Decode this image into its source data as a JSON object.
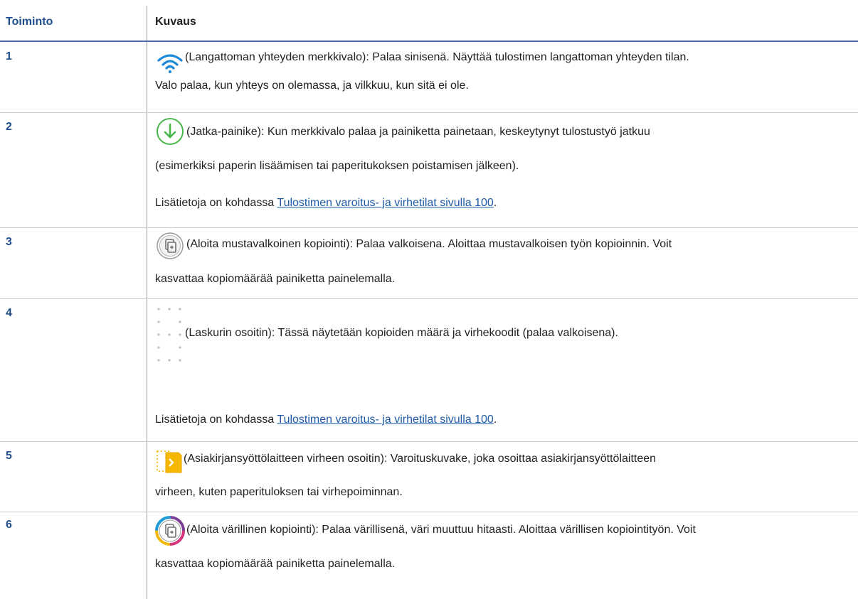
{
  "header": {
    "col1": "Toiminto",
    "col2": "Kuvaus"
  },
  "colors": {
    "accent": "#1f4f8f",
    "link": "#1f5aa6",
    "wifi": "#1e88d8",
    "resume": "#49b84a"
  },
  "rows": [
    {
      "num": "1",
      "icon": "wifi-icon",
      "lines": [
        "(Langattoman yhteyden merkkivalo): Palaa sinisenä. Näyttää tulostimen langattoman yhteyden tilan.",
        "Valo palaa, kun yhteys on olemassa, ja vilkkuu, kun sitä ei ole."
      ]
    },
    {
      "num": "2",
      "icon": "resume-icon",
      "lines": [
        "(Jatka-painike): Kun merkkivalo palaa ja painiketta painetaan, keskeytynyt tulostustyö jatkuu",
        "(esimerkiksi paperin lisäämisen tai paperitukoksen poistamisen jälkeen)."
      ],
      "more_prefix": "Lisätietoja on kohdassa ",
      "more_link": "Tulostimen varoitus- ja virhetilat sivulla 100",
      "more_suffix": "."
    },
    {
      "num": "3",
      "icon": "mono-copy-icon",
      "lines": [
        "(Aloita mustavalkoinen kopiointi): Palaa valkoisena. Aloittaa mustavalkoisen työn kopioinnin. Voit",
        "kasvattaa kopiomäärää painiketta painelemalla."
      ]
    },
    {
      "num": "4",
      "icon": "counter-display-icon",
      "lines": [
        "(Laskurin osoitin): Tässä näytetään kopioiden määrä ja virhekoodit (palaa valkoisena)."
      ],
      "more_prefix": "Lisätietoja on kohdassa ",
      "more_link": "Tulostimen varoitus- ja virhetilat sivulla 100",
      "more_suffix": "."
    },
    {
      "num": "5",
      "icon": "adf-error-icon",
      "lines": [
        "(Asiakirjansyöttölaitteen virheen osoitin): Varoituskuvake, joka osoittaa asiakirjansyöttölaitteen",
        "virheen, kuten paperituloksen tai virhepoiminnan."
      ]
    },
    {
      "num": "6",
      "icon": "color-copy-icon",
      "lines": [
        "(Aloita värillinen kopiointi): Palaa värillisenä, väri muuttuu hitaasti. Aloittaa värillisen kopiointityön. Voit",
        "kasvattaa kopiomäärää painiketta painelemalla."
      ]
    }
  ]
}
